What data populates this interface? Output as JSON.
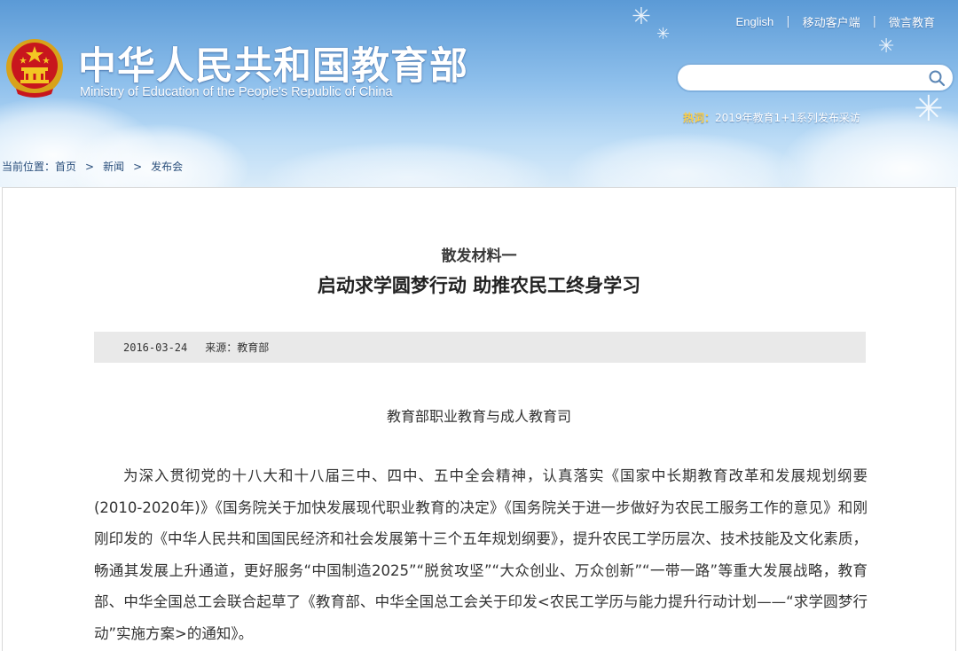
{
  "colors": {
    "header_gradient_top": "#5b9ad6",
    "header_gradient_bottom": "#d9ebf9",
    "hot_label": "#ffd046",
    "meta_bar": "#e9e9e9"
  },
  "header": {
    "title": "中华人民共和国教育部",
    "subtitle": "Ministry of Education of the People's Republic of China",
    "emblem_icon": "national-emblem-icon",
    "links": [
      {
        "label": "English"
      },
      {
        "label": "移动客户端"
      },
      {
        "label": "微言教育"
      }
    ],
    "link_separator": "|",
    "search": {
      "value": "",
      "placeholder": "",
      "icon": "search-icon"
    },
    "hot": {
      "label": "热词：",
      "text": "2019年教育1+1系列发布采访"
    }
  },
  "breadcrumb": {
    "prefix": "当前位置：",
    "items": [
      "首页",
      "新闻",
      "发布会"
    ],
    "separator": ">"
  },
  "article": {
    "label": "散发材料一",
    "title": "启动求学圆梦行动 助推农民工终身学习",
    "date": "2016-03-24",
    "source": "来源：教育部",
    "author": "教育部职业教育与成人教育司",
    "paragraph": "为深入贯彻党的十八大和十八届三中、四中、五中全会精神，认真落实《国家中长期教育改革和发展规划纲要(2010-2020年)》《国务院关于加快发展现代职业教育的决定》《国务院关于进一步做好为农民工服务工作的意见》和刚刚印发的《中华人民共和国国民经济和社会发展第十三个五年规划纲要》，提升农民工学历层次、技术技能及文化素质，畅通其发展上升通道，更好服务“中国制造2025”“脱贫攻坚”“大众创业、万众创新”“一带一路”等重大发展战略，教育部、中华全国总工会联合起草了《教育部、中华全国总工会关于印发<农民工学历与能力提升行动计划——“求学圆梦行动”实施方案>的通知》。"
  }
}
